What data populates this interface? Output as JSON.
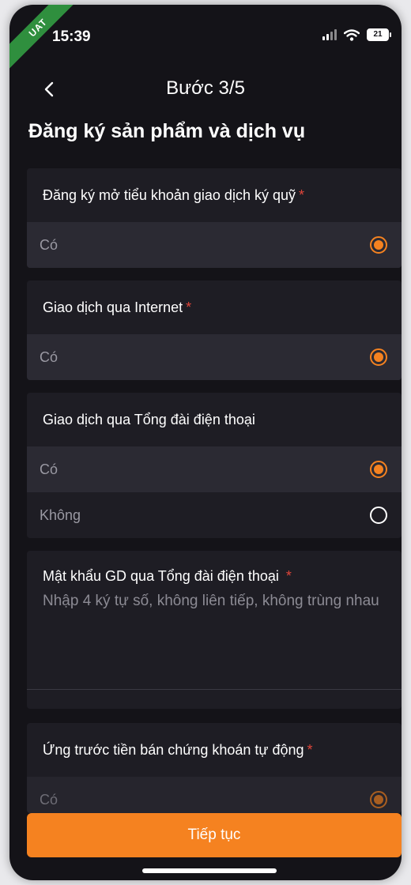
{
  "status_bar": {
    "time": "15:39",
    "battery": "21",
    "badge": "UAT"
  },
  "header": {
    "title": "Bước 3/5",
    "back_icon": "chevron-left-icon"
  },
  "section_title": "Đăng ký sản phẩm và dịch vụ",
  "cards": [
    {
      "label": "Đăng ký mở tiểu khoản giao dịch ký quỹ",
      "required": "*",
      "options": [
        "Có"
      ]
    },
    {
      "label": "Giao dịch qua Internet",
      "required": "*",
      "options": [
        "Có"
      ]
    },
    {
      "label": "Giao dịch qua Tổng đài điện thoại",
      "options": [
        "Có",
        "Không"
      ]
    },
    {
      "label": "Ứng trước tiền bán chứng khoán tự động",
      "required": "*",
      "options": [
        "Có"
      ]
    }
  ],
  "password_field": {
    "label": "Mật khẩu GD qua Tổng đài điện thoại",
    "required": "*",
    "placeholder": "Nhập 4 ký tự số, không liên tiếp, không trùng nhau",
    "value": ""
  },
  "continue_button": "Tiếp tục",
  "colors": {
    "accent": "#f58220",
    "background": "#141318",
    "card": "#1e1d24",
    "required": "#e0453a"
  }
}
